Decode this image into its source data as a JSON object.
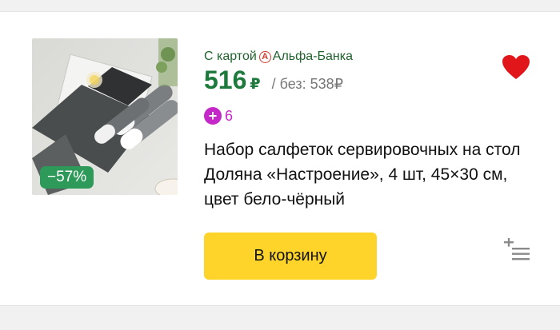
{
  "product": {
    "discount_badge": "−57%",
    "bank": {
      "prefix": "С картой",
      "icon_letter": "А",
      "name": "Альфа-Банка",
      "icon": "alfa-bank-icon"
    },
    "price": {
      "current": "516",
      "currency": "₽",
      "old": "/ без: 538₽"
    },
    "plus": {
      "icon_symbol": "+",
      "points": "6"
    },
    "title": "Набор салфеток сервировочных на стол Доляна «Настроение», 4 шт, 45×30 см, цвет бело-чёрный",
    "cart_button_label": "В корзину",
    "icons": {
      "favorite": "heart-icon",
      "compare": "add-to-list-icon"
    },
    "colors": {
      "price": "#1d7a3c",
      "badge": "#2e9a5a",
      "cart_button": "#fed42b",
      "favorite": "#e0161b",
      "plus": "#c528c8"
    }
  }
}
